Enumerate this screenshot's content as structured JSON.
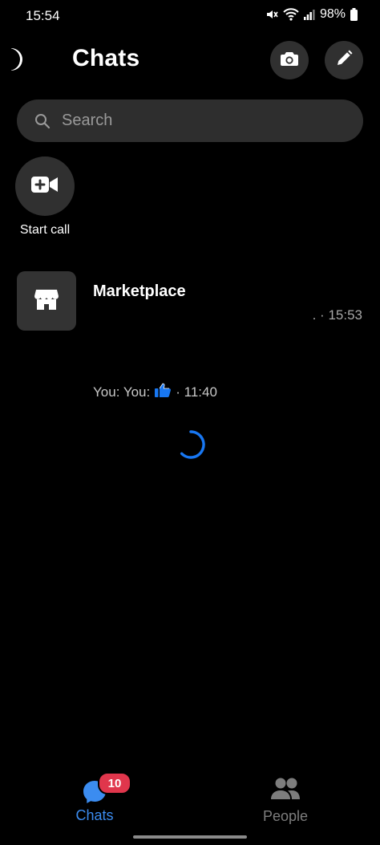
{
  "status_bar": {
    "time": "15:54",
    "battery": "98%",
    "icons": [
      "mute-icon",
      "wifi-icon",
      "signal-icon",
      "battery-icon"
    ]
  },
  "header": {
    "title": "Chats",
    "actions": [
      "camera-icon",
      "pencil-icon"
    ]
  },
  "search": {
    "placeholder": "Search"
  },
  "start_call": {
    "label": "Start call"
  },
  "chat_list": {
    "marketplace": {
      "name": "Marketplace",
      "time": "15:53",
      "separator": ". · "
    },
    "preview": {
      "text": "You: You:",
      "emoji": "thumbs-up-icon",
      "time": "· 11:40"
    }
  },
  "bottom_nav": {
    "chats": {
      "label": "Chats",
      "badge": "10",
      "color": "#3b8cf0"
    },
    "people": {
      "label": "People",
      "color": "#7d7d7d"
    }
  },
  "colors": {
    "background": "#000000",
    "surface": "#303030",
    "accent": "#3b8cf0",
    "badge": "#e0364c"
  }
}
